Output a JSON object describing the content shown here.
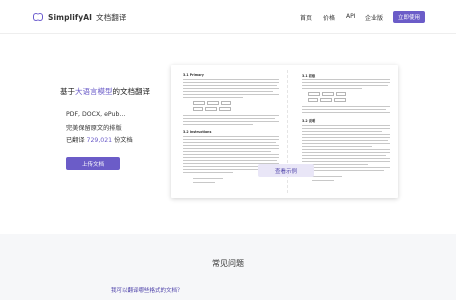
{
  "header": {
    "brand_name": "SimplifyAI",
    "brand_subtitle": "文档翻译",
    "nav": {
      "home": "首页",
      "pricing": "价格",
      "api": "API",
      "enterprise": "企业版"
    },
    "cta_label": "立即使用",
    "brand_color": "#6b5cc8"
  },
  "hero": {
    "title_prefix": "基于",
    "title_highlight": "大语言模型",
    "title_suffix": "的文档翻译",
    "features": {
      "formats": "PDF, DOCX, ePub...",
      "layout": "完美保留原文的排版",
      "count_prefix": "已翻译",
      "count_value": "729,021",
      "count_suffix": "份文档"
    },
    "upload_label": "上传文档"
  },
  "preview": {
    "left_heading_1": "3.1 Primary",
    "left_heading_2": "3.2 Instructions",
    "right_heading_1": "3.1 初级",
    "right_heading_2": "3.2 说明",
    "view_example_label": "查看示例"
  },
  "faq": {
    "title": "常见问题",
    "questions": [
      "我可以翻译哪些格式的文档？"
    ]
  }
}
